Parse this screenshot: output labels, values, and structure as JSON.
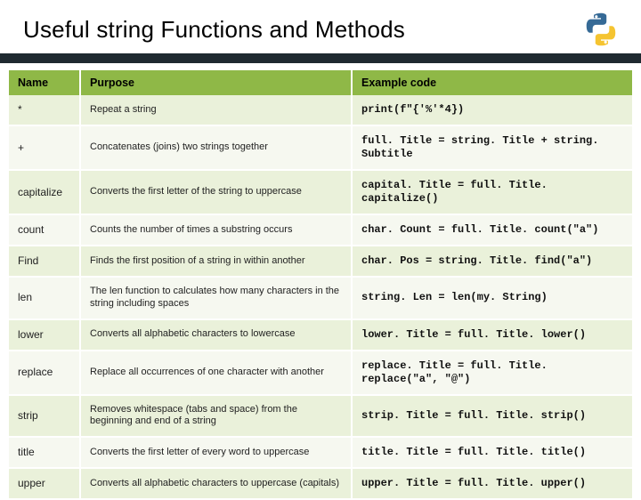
{
  "title": "Useful string Functions and Methods",
  "headers": {
    "name": "Name",
    "purpose": "Purpose",
    "code": "Example code"
  },
  "rows": [
    {
      "name": "*",
      "purpose": "Repeat a string",
      "code": "print(f\"{'%'*4})"
    },
    {
      "name": "+",
      "purpose": "Concatenates (joins) two strings together",
      "code": "full. Title = string. Title + string. Subtitle"
    },
    {
      "name": "capitalize",
      "purpose": "Converts the first letter of the string to uppercase",
      "code": "capital. Title = full. Title. capitalize()"
    },
    {
      "name": "count",
      "purpose": "Counts the number of times a substring occurs",
      "code": "char. Count = full. Title. count(\"a\")"
    },
    {
      "name": "Find",
      "purpose": "Finds the first position of a string in within another",
      "code": "char. Pos = string. Title. find(\"a\")"
    },
    {
      "name": "len",
      "purpose": "The len function to calculates how many characters in the string including spaces",
      "code": "string. Len = len(my. String)"
    },
    {
      "name": "lower",
      "purpose": "Converts all alphabetic characters to lowercase",
      "code": "lower. Title = full. Title. lower()"
    },
    {
      "name": "replace",
      "purpose": "Replace all occurrences of one character with another",
      "code": "replace. Title = full. Title. replace(\"a\", \"@\")"
    },
    {
      "name": "strip",
      "purpose": "Removes whitespace (tabs and space) from the beginning and end of a string",
      "code": "strip. Title = full. Title. strip()"
    },
    {
      "name": "title",
      "purpose": "Converts the first letter of every word to uppercase",
      "code": "title. Title = full. Title. title()"
    },
    {
      "name": "upper",
      "purpose": "Converts all alphabetic characters to uppercase (capitals)",
      "code": "upper. Title = full. Title. upper()"
    }
  ]
}
